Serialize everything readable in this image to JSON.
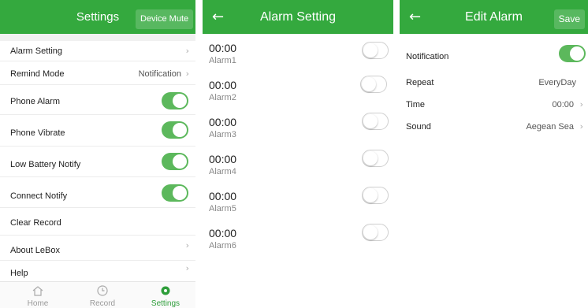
{
  "settings": {
    "title": "Settings",
    "mute_button": "Device Mute",
    "items": {
      "alarm_setting": "Alarm Setting",
      "remind_mode": "Remind Mode",
      "remind_mode_value": "Notification",
      "phone_alarm": "Phone Alarm",
      "phone_vibrate": "Phone Vibrate",
      "low_battery": "Low Battery Notify",
      "connect_notify": "Connect Notify",
      "clear_record": "Clear Record",
      "about": "About LeBox",
      "help": "Help"
    },
    "toggles": {
      "phone_alarm": true,
      "phone_vibrate": true,
      "low_battery": true,
      "connect_notify": true
    }
  },
  "tabbar": {
    "home": "Home",
    "record": "Record",
    "settings": "Settings",
    "active": "settings"
  },
  "alarm_setting": {
    "title": "Alarm Setting",
    "back_icon": "back-arrow-icon",
    "alarms": [
      {
        "time": "00:00",
        "name": "Alarm1",
        "enabled": false
      },
      {
        "time": "00:00",
        "name": "Alarm2",
        "enabled": false
      },
      {
        "time": "00:00",
        "name": "Alarm3",
        "enabled": false
      },
      {
        "time": "00:00",
        "name": "Alarm4",
        "enabled": false
      },
      {
        "time": "00:00",
        "name": "Alarm5",
        "enabled": false
      },
      {
        "time": "00:00",
        "name": "Alarm6",
        "enabled": false
      }
    ]
  },
  "edit_alarm": {
    "title": "Edit Alarm",
    "save": "Save",
    "notification_label": "Notification",
    "notification_on": true,
    "repeat_label": "Repeat",
    "repeat_value": "EveryDay",
    "time_label": "Time",
    "time_value": "00:00",
    "sound_label": "Sound",
    "sound_value": "Aegean Sea"
  },
  "colors": {
    "accent": "#34a93e",
    "toggle_on": "#5cb85c"
  }
}
